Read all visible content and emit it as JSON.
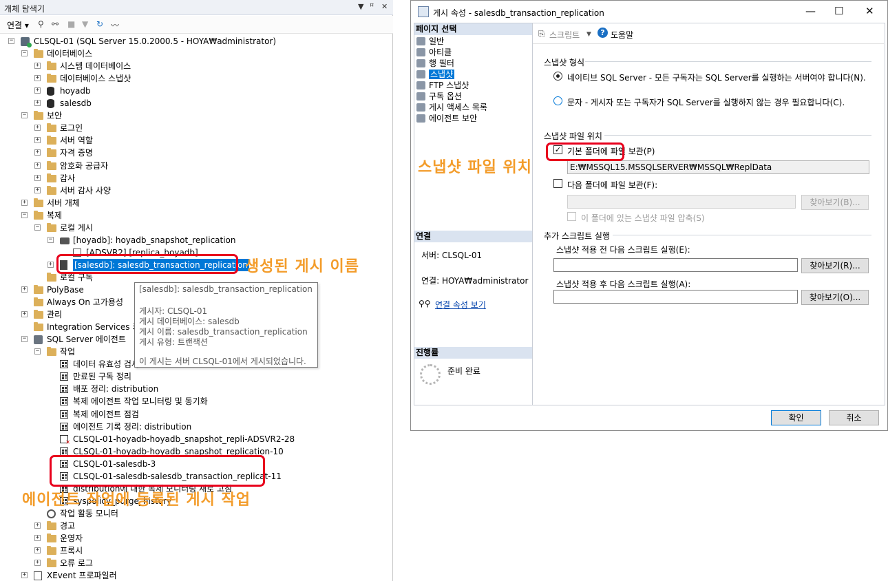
{
  "object_explorer": {
    "title": "개체 탐색기",
    "title_controls": [
      "▼",
      "ꟸ",
      "✕"
    ],
    "toolbar": {
      "connect_label": "연결 ▾"
    },
    "tree": [
      {
        "label": "CLSQL-01 (SQL Server 15.0.2000.5 - HOYA₩administrator)",
        "icon": "server-icon",
        "depth": 0,
        "expander": "⊟"
      },
      {
        "label": "데이터베이스",
        "icon": "folder-icon",
        "depth": 1,
        "expander": "⊟"
      },
      {
        "label": "시스템 데이터베이스",
        "icon": "folder-icon",
        "depth": 2,
        "expander": "⊞"
      },
      {
        "label": "데이터베이스 스냅샷",
        "icon": "folder-icon",
        "depth": 2,
        "expander": "⊞"
      },
      {
        "label": "hoyadb",
        "icon": "database-icon",
        "depth": 2,
        "expander": "⊞"
      },
      {
        "label": "salesdb",
        "icon": "database-icon",
        "depth": 2,
        "expander": "⊞"
      },
      {
        "label": "보안",
        "icon": "folder-icon",
        "depth": 1,
        "expander": "⊟"
      },
      {
        "label": "로그인",
        "icon": "folder-icon",
        "depth": 2,
        "expander": "⊞"
      },
      {
        "label": "서버 역할",
        "icon": "folder-icon",
        "depth": 2,
        "expander": "⊞"
      },
      {
        "label": "자격 증명",
        "icon": "folder-icon",
        "depth": 2,
        "expander": "⊞"
      },
      {
        "label": "암호화 공급자",
        "icon": "folder-icon",
        "depth": 2,
        "expander": "⊞"
      },
      {
        "label": "감사",
        "icon": "folder-icon",
        "depth": 2,
        "expander": "⊞"
      },
      {
        "label": "서버 감사 사양",
        "icon": "folder-icon",
        "depth": 2,
        "expander": "⊞"
      },
      {
        "label": "서버 개체",
        "icon": "folder-icon",
        "depth": 1,
        "expander": "⊞"
      },
      {
        "label": "복제",
        "icon": "folder-icon",
        "depth": 1,
        "expander": "⊟"
      },
      {
        "label": "로컬 게시",
        "icon": "folder-icon",
        "depth": 2,
        "expander": "⊟"
      },
      {
        "label": "[hoyadb]: hoyadb_snapshot_replication",
        "icon": "camera-icon",
        "depth": 3,
        "expander": "⊟"
      },
      {
        "label": "[ADSVR2].[replica_hoyadb]",
        "icon": "subscription-icon",
        "depth": 4,
        "expander": ""
      },
      {
        "label": "[salesdb]: salesdb_transaction_replication",
        "icon": "publication-icon",
        "depth": 3,
        "expander": "⊞",
        "selected": true
      },
      {
        "label": "로컬 구독",
        "icon": "folder-icon",
        "depth": 2,
        "expander": ""
      },
      {
        "label": "PolyBase",
        "icon": "folder-icon",
        "depth": 1,
        "expander": "⊞"
      },
      {
        "label": "Always On 고가용성",
        "icon": "folder-icon",
        "depth": 1,
        "expander": ""
      },
      {
        "label": "관리",
        "icon": "folder-icon",
        "depth": 1,
        "expander": "⊞"
      },
      {
        "label": "Integration Services 카탈로그",
        "icon": "folder-icon",
        "depth": 1,
        "expander": ""
      },
      {
        "label": "SQL Server 에이전트",
        "icon": "agent-icon",
        "depth": 1,
        "expander": "⊟"
      },
      {
        "label": "작업",
        "icon": "folder-icon",
        "depth": 2,
        "expander": "⊟"
      },
      {
        "label": "데이터 유효성 검사",
        "icon": "job-icon",
        "depth": 3,
        "expander": ""
      },
      {
        "label": "만료된 구독 정리",
        "icon": "job-icon",
        "depth": 3,
        "expander": ""
      },
      {
        "label": "배포 정리: distribution",
        "icon": "job-icon",
        "depth": 3,
        "expander": ""
      },
      {
        "label": "복제 에이전트 작업 모니터링 및 동기화",
        "icon": "job-icon",
        "depth": 3,
        "expander": ""
      },
      {
        "label": "복제 에이전트 점검",
        "icon": "job-icon",
        "depth": 3,
        "expander": ""
      },
      {
        "label": "에이전트 기록 정리: distribution",
        "icon": "job-icon",
        "depth": 3,
        "expander": ""
      },
      {
        "label": "CLSQL-01-hoyadb-hoyadb_snapshot_repli-ADSVR2-28",
        "icon": "job-failed-icon",
        "depth": 3,
        "expander": ""
      },
      {
        "label": "CLSQL-01-hoyadb-hoyadb_snapshot_replication-10",
        "icon": "job-icon",
        "depth": 3,
        "expander": ""
      },
      {
        "label": "CLSQL-01-salesdb-3",
        "icon": "job-icon",
        "depth": 3,
        "expander": ""
      },
      {
        "label": "CLSQL-01-salesdb-salesdb_transaction_replicat-11",
        "icon": "job-icon",
        "depth": 3,
        "expander": ""
      },
      {
        "label": "distribution에 대한 복제 모니터링 새로 고침",
        "icon": "job-icon",
        "depth": 3,
        "expander": ""
      },
      {
        "label": "syspolicy_purge_history",
        "icon": "job-icon",
        "depth": 3,
        "expander": ""
      },
      {
        "label": "작업 활동 모니터",
        "icon": "monitor-icon",
        "depth": 2,
        "expander": ""
      },
      {
        "label": "경고",
        "icon": "folder-icon",
        "depth": 2,
        "expander": "⊞"
      },
      {
        "label": "운영자",
        "icon": "folder-icon",
        "depth": 2,
        "expander": "⊞"
      },
      {
        "label": "프록시",
        "icon": "folder-icon",
        "depth": 2,
        "expander": "⊞"
      },
      {
        "label": "오류 로그",
        "icon": "folder-icon",
        "depth": 2,
        "expander": "⊞"
      },
      {
        "label": "XEvent 프로파일러",
        "icon": "xevent-icon",
        "depth": 1,
        "expander": "⊞"
      }
    ],
    "tooltip": {
      "line1": "[salesdb]: salesdb_transaction_replication",
      "line2": "게시자:   CLSQL-01",
      "line3": "게시 데이터베이스:   salesdb",
      "line4": "게시 이름:   salesdb_transaction_replication",
      "line5": "게시 유형:   트랜잭션",
      "line6": "이 게시는 서버 CLSQL-01에서 게시되었습니다."
    }
  },
  "annotations": {
    "publication_name": "생성된 게시 이름",
    "agent_jobs": "에이전트 작업에 등록된 게시 작업",
    "snapshot_location": "스냅샷 파일 위치"
  },
  "dialog": {
    "title": "게시 속성 - salesdb_transaction_replication",
    "window_buttons": {
      "minimize": "—",
      "maximize": "☐",
      "close": "✕"
    },
    "nav_header": "페이지 선택",
    "nav_items": [
      "일반",
      "아티클",
      "행 필터",
      "스냅샷",
      "FTP 스냅샷",
      "구독 옵션",
      "게시 액세스 목록",
      "에이전트 보안"
    ],
    "connection_header": "연결",
    "server_label": "서버: CLSQL-01",
    "connection_label": "연결: HOYA₩administrator",
    "view_conn_props": "연결 속성 보기",
    "progress_header": "진행률",
    "progress_status": "준비 완료",
    "script_label": "스크립트",
    "help_label": "도움말",
    "snapshot_format_title": "스냅샷 형식",
    "radio_native": "네이티브 SQL Server - 모든 구독자는 SQL Server를 실행하는 서버여야 합니다(N).",
    "radio_char": "문자 - 게시자 또는 구독자가 SQL Server를 실행하지 않는 경우 필요합니다(C).",
    "snapshot_loc_title": "스냅샷 파일 위치",
    "chk_default": "기본 폴더에 파일 보관(P)",
    "default_path": "E:₩MSSQL15.MSSQLSERVER₩MSSQL₩ReplData",
    "chk_other": "다음 폴더에 파일 보관(F):",
    "other_path": "",
    "browse_b": "찾아보기(B)...",
    "chk_compress": "이 폴더에 있는 스냅샷 파일 압축(S)",
    "extra_scripts_title": "추가 스크립트 실행",
    "before_label": "스냅샷 적용 전 다음 스크립트 실행(E):",
    "before_value": "",
    "browse_r": "찾아보기(R)...",
    "after_label": "스냅샷 적용 후 다음 스크립트 실행(A):",
    "after_value": "",
    "browse_o": "찾아보기(O)...",
    "ok": "확인",
    "cancel": "취소"
  },
  "colors": {
    "accent": "#0078d7",
    "annotation_box": "#e8001c",
    "annotation_text": "#f39c2a"
  }
}
